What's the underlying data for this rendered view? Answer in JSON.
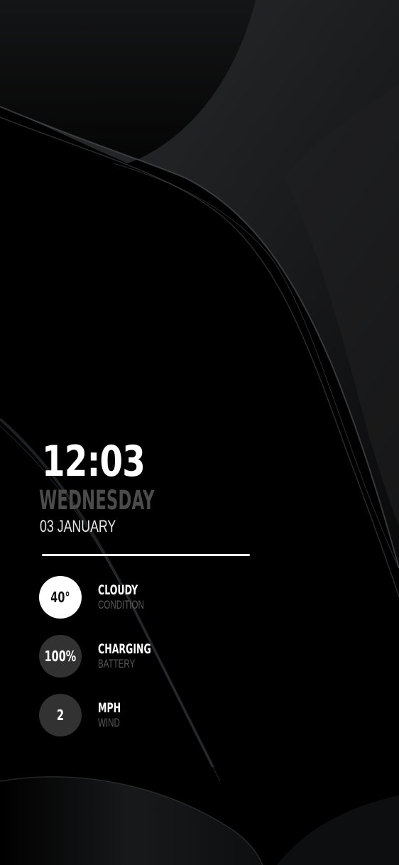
{
  "clock": {
    "time": "12:03",
    "weekday": "WEDNESDAY",
    "date": "03 JANUARY"
  },
  "stats": [
    {
      "value": "40°",
      "label": "CLOUDY",
      "sublabel": "CONDITION"
    },
    {
      "value": "100%",
      "label": "CHARGING",
      "sublabel": "BATTERY"
    },
    {
      "value": "2",
      "label": "MPH",
      "sublabel": "WIND"
    }
  ],
  "colors": {
    "background": "#000000",
    "text_primary": "#ffffff",
    "weekday": "#4b4b4b",
    "sublabel": "#5a5a5a",
    "circle_light": "#ffffff",
    "circle_dark": "#323232"
  }
}
